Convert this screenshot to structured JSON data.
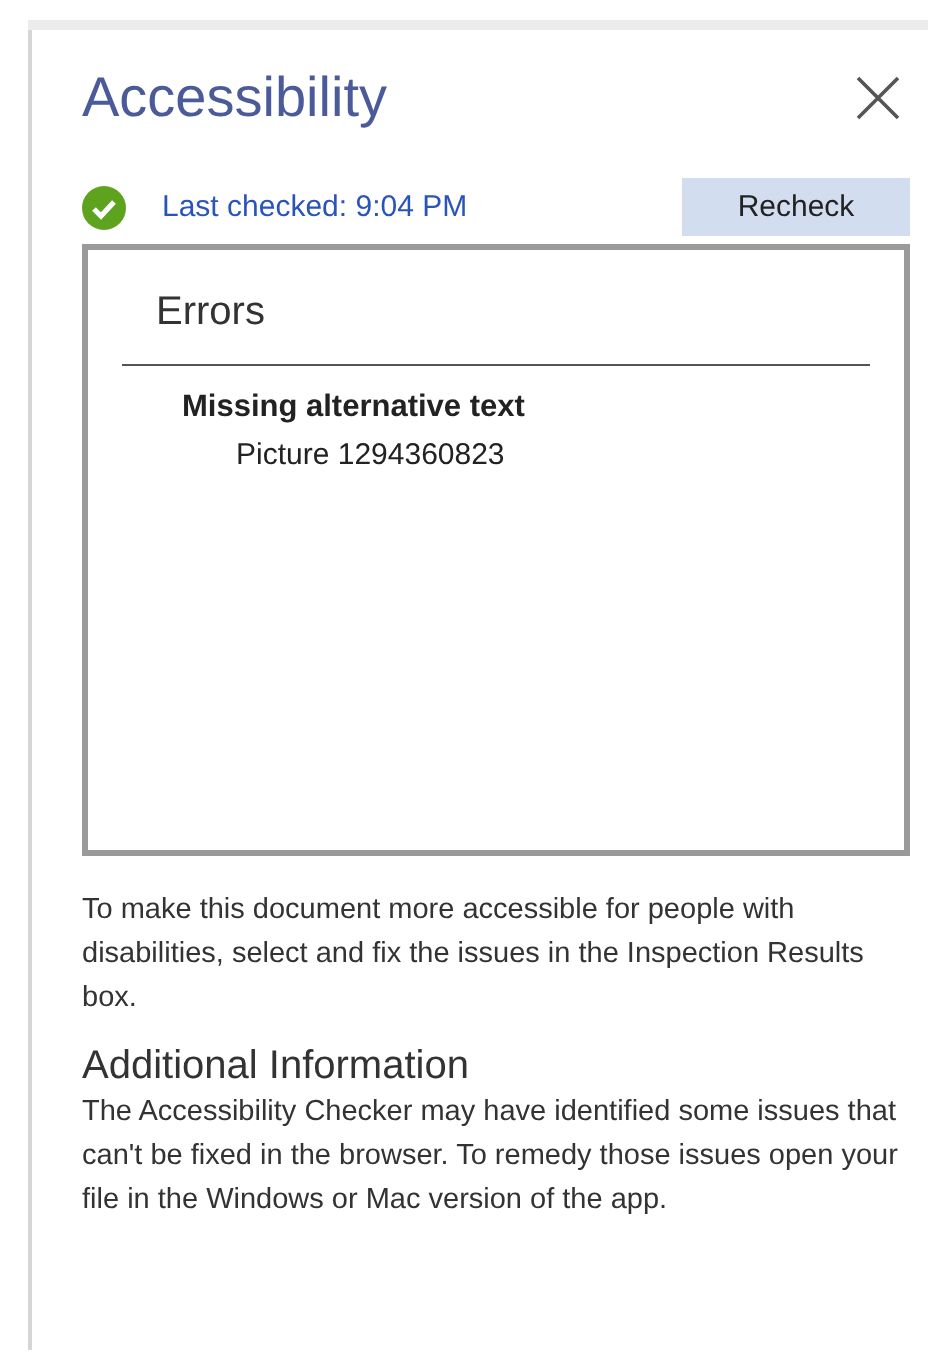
{
  "pane": {
    "title": "Accessibility"
  },
  "status": {
    "ok": true,
    "text": "Last checked: 9:04 PM",
    "button": "Recheck"
  },
  "results": {
    "heading": "Errors",
    "items": [
      {
        "title": "Missing alternative text",
        "detail": "Picture 1294360823"
      }
    ]
  },
  "description": "To make this document more accessible for people with disabilities, select and fix the issues in the Inspection Results box.",
  "additional": {
    "heading": "Additional Information",
    "text": "The Accessibility Checker may have identified some issues that can't be fixed in the browser. To remedy those issues open your file in the Windows or Mac version of the app."
  }
}
